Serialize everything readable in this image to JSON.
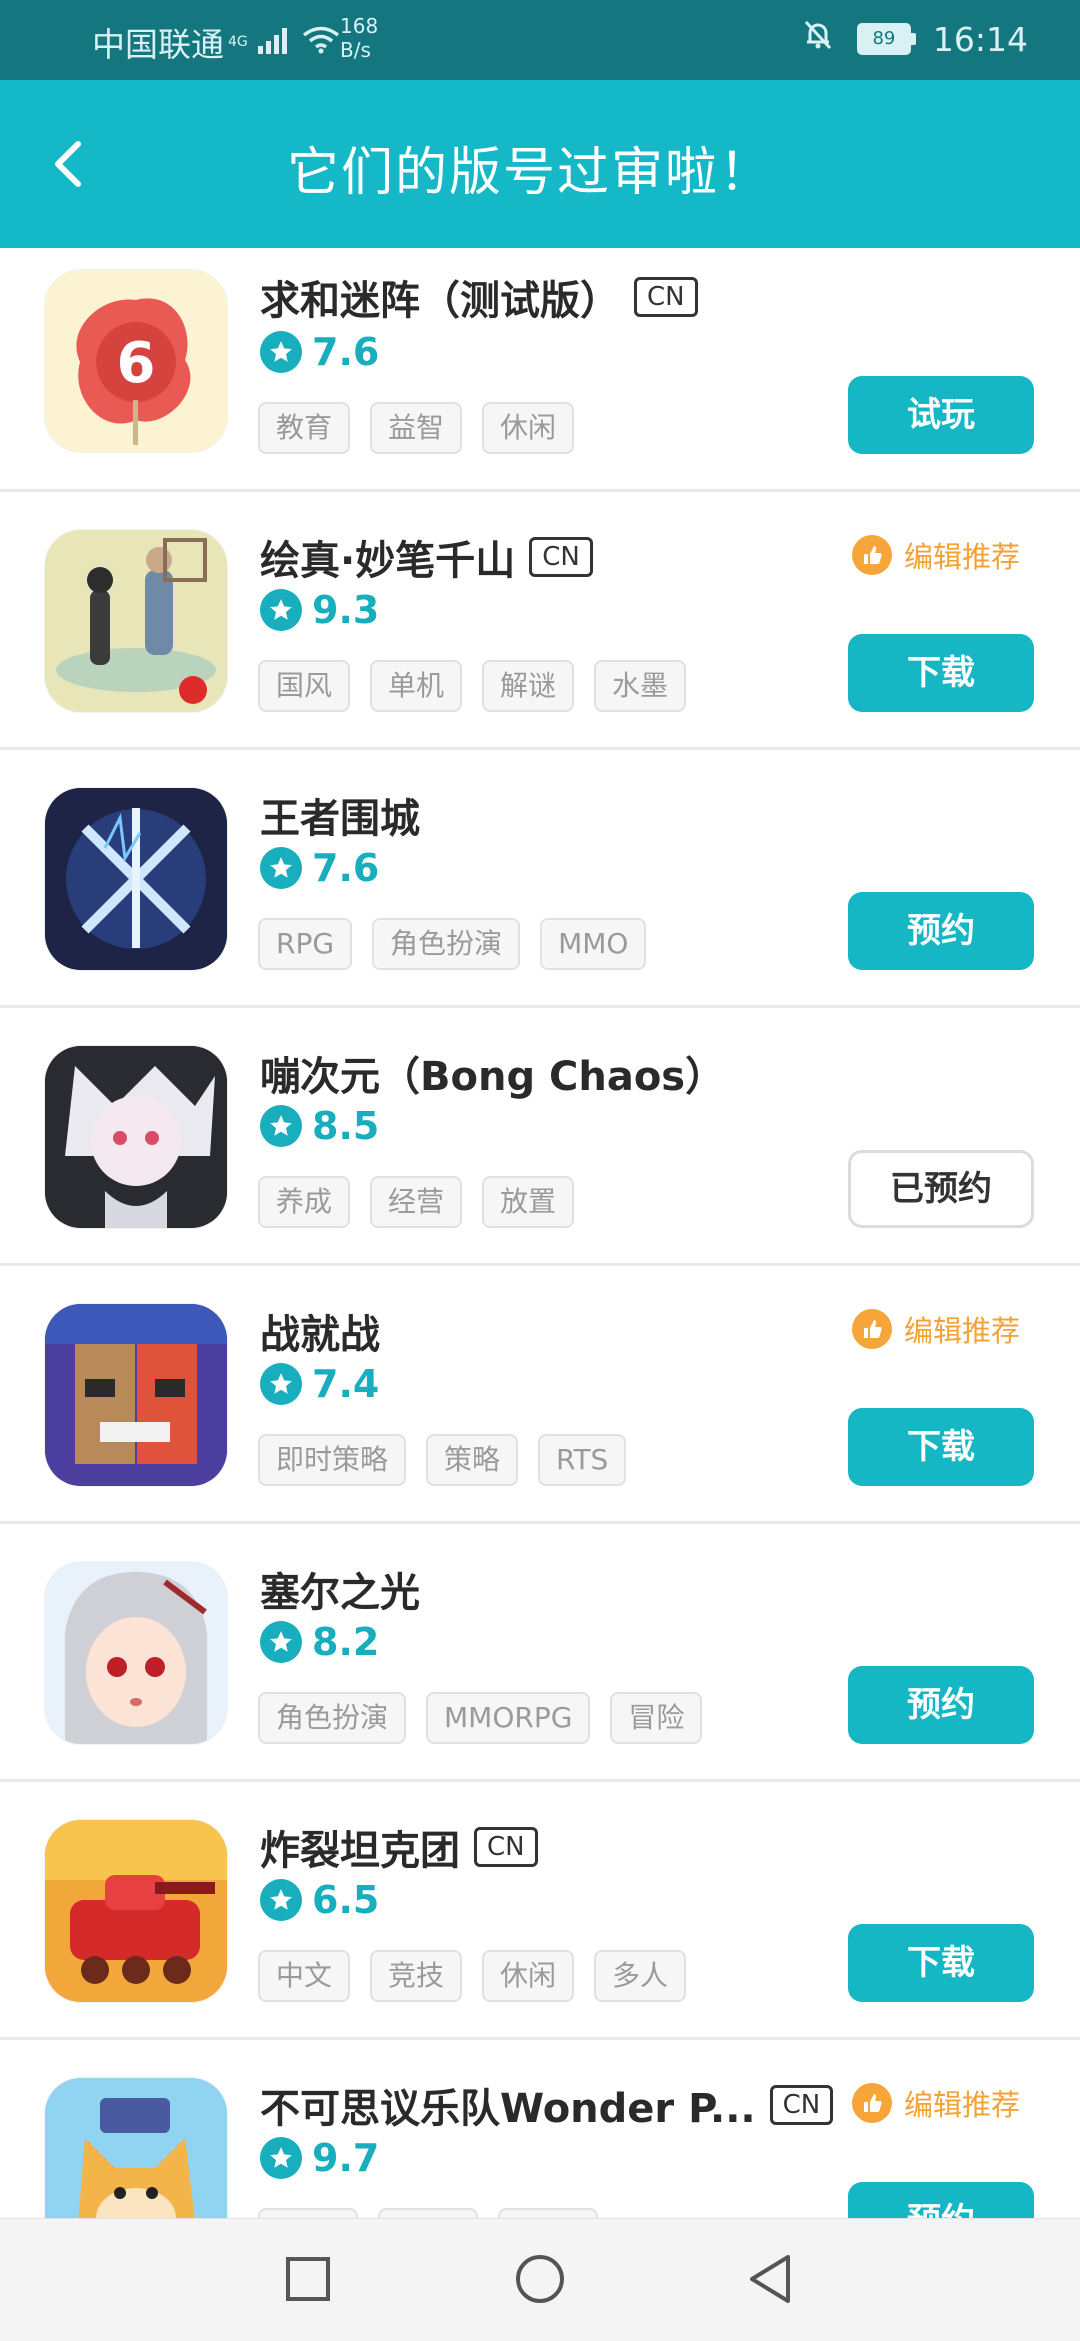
{
  "status_bar": {
    "carrier": "中国联通",
    "network": "4G",
    "speed_value": "168",
    "speed_unit": "B/s",
    "battery": "89",
    "time": "16:14"
  },
  "header": {
    "title": "它们的版号过审啦！",
    "back_icon": "chevron-left-icon"
  },
  "colors": {
    "status_bar_bg": "#14767f",
    "header_bg": "#14b8c6",
    "accent": "#16b7c5",
    "editor_badge": "#f4a236"
  },
  "labels": {
    "editor_recommend": "编辑推荐",
    "cn": "CN"
  },
  "apps": [
    {
      "name": "求和迷阵（测试版）",
      "cn": true,
      "rating": "7.6",
      "tags": [
        "教育",
        "益智",
        "休闲"
      ],
      "action": "试玩",
      "editor_pick": false,
      "button_style": "filled"
    },
    {
      "name": "绘真·妙笔千山",
      "cn": true,
      "rating": "9.3",
      "tags": [
        "国风",
        "单机",
        "解谜",
        "水墨"
      ],
      "action": "下载",
      "editor_pick": true,
      "button_style": "filled"
    },
    {
      "name": "王者围城",
      "cn": false,
      "rating": "7.6",
      "tags": [
        "RPG",
        "角色扮演",
        "MMO"
      ],
      "action": "预约",
      "editor_pick": false,
      "button_style": "filled"
    },
    {
      "name": "嘣次元（Bong Chaos）",
      "cn": false,
      "rating": "8.5",
      "tags": [
        "养成",
        "经营",
        "放置"
      ],
      "action": "已预约",
      "editor_pick": false,
      "button_style": "outline"
    },
    {
      "name": "战就战",
      "cn": false,
      "rating": "7.4",
      "tags": [
        "即时策略",
        "策略",
        "RTS"
      ],
      "action": "下载",
      "editor_pick": true,
      "button_style": "filled"
    },
    {
      "name": "塞尔之光",
      "cn": false,
      "rating": "8.2",
      "tags": [
        "角色扮演",
        "MMORPG",
        "冒险"
      ],
      "action": "预约",
      "editor_pick": false,
      "button_style": "filled"
    },
    {
      "name": "炸裂坦克团",
      "cn": true,
      "rating": "6.5",
      "tags": [
        "中文",
        "竞技",
        "休闲",
        "多人"
      ],
      "action": "下载",
      "editor_pick": false,
      "button_style": "filled"
    },
    {
      "name": "不可思议乐队Wonder P...",
      "cn": true,
      "rating": "9.7",
      "tags": [],
      "action": "预约",
      "editor_pick": true,
      "button_style": "filled"
    }
  ],
  "nav_bar": {
    "recent": "square-icon",
    "home": "circle-icon",
    "back": "triangle-back-icon"
  }
}
